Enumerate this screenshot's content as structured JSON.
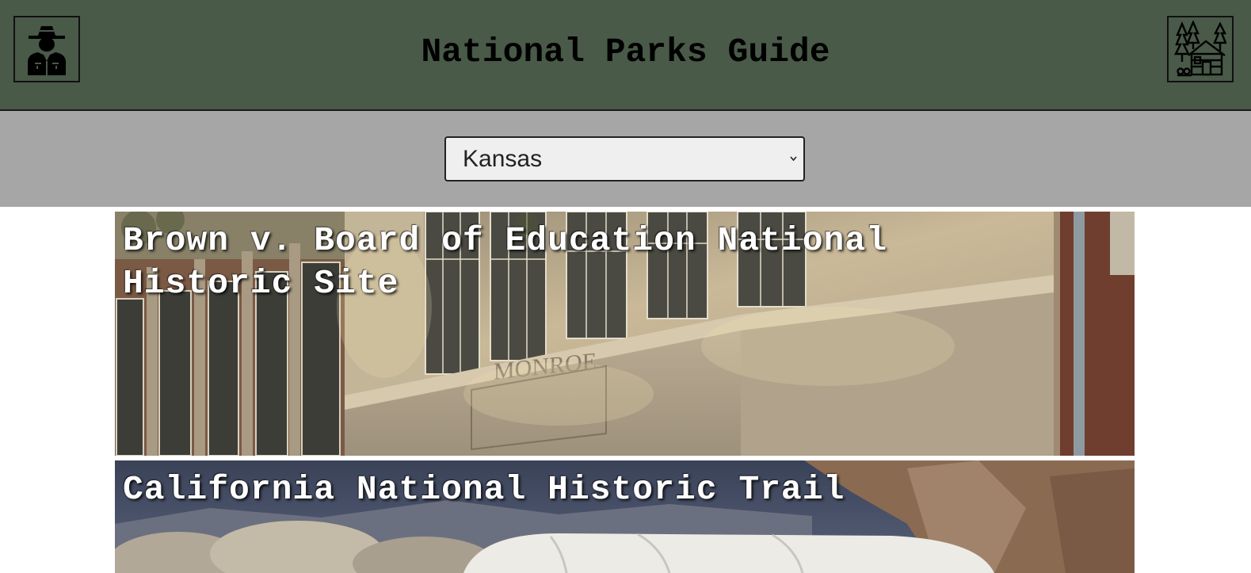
{
  "header": {
    "title": "National Parks Guide",
    "left_logo_icon": "park-ranger-icon",
    "right_logo_icon": "cabin-in-forest-icon",
    "background_color": "#495a48"
  },
  "filter": {
    "selected_state": "Kansas",
    "background_color": "#a6a6a6"
  },
  "parks": [
    {
      "name": "Brown v. Board of Education National Historic Site"
    },
    {
      "name": "California National Historic Trail"
    }
  ]
}
